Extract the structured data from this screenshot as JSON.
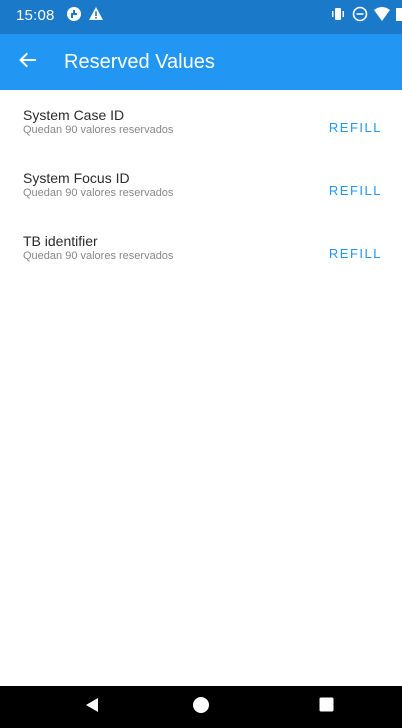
{
  "status_bar": {
    "time": "15:08",
    "left_icons": [
      "data-saver-icon",
      "warning-icon"
    ],
    "right_icons": [
      "vibrate-icon",
      "do-not-disturb-icon",
      "wifi-icon",
      "battery-icon"
    ]
  },
  "app_bar": {
    "title": "Reserved Values",
    "back_icon": "arrow-back-icon",
    "background": "#2196f3",
    "status_background": "#1a79c9"
  },
  "items": [
    {
      "title": "System Case ID",
      "subtitle": "Quedan 90 valores reservados",
      "action": "REFILL"
    },
    {
      "title": "System Focus ID",
      "subtitle": "Quedan 90 valores reservados",
      "action": "REFILL"
    },
    {
      "title": "TB identifier",
      "subtitle": "Quedan 90 valores reservados",
      "action": "REFILL"
    }
  ],
  "nav_bar": {
    "buttons": [
      "back-triangle-icon",
      "home-circle-icon",
      "recents-square-icon"
    ]
  },
  "colors": {
    "accent": "#2196f3",
    "title_text": "#2b2b2b",
    "subtitle_text": "#888888"
  }
}
